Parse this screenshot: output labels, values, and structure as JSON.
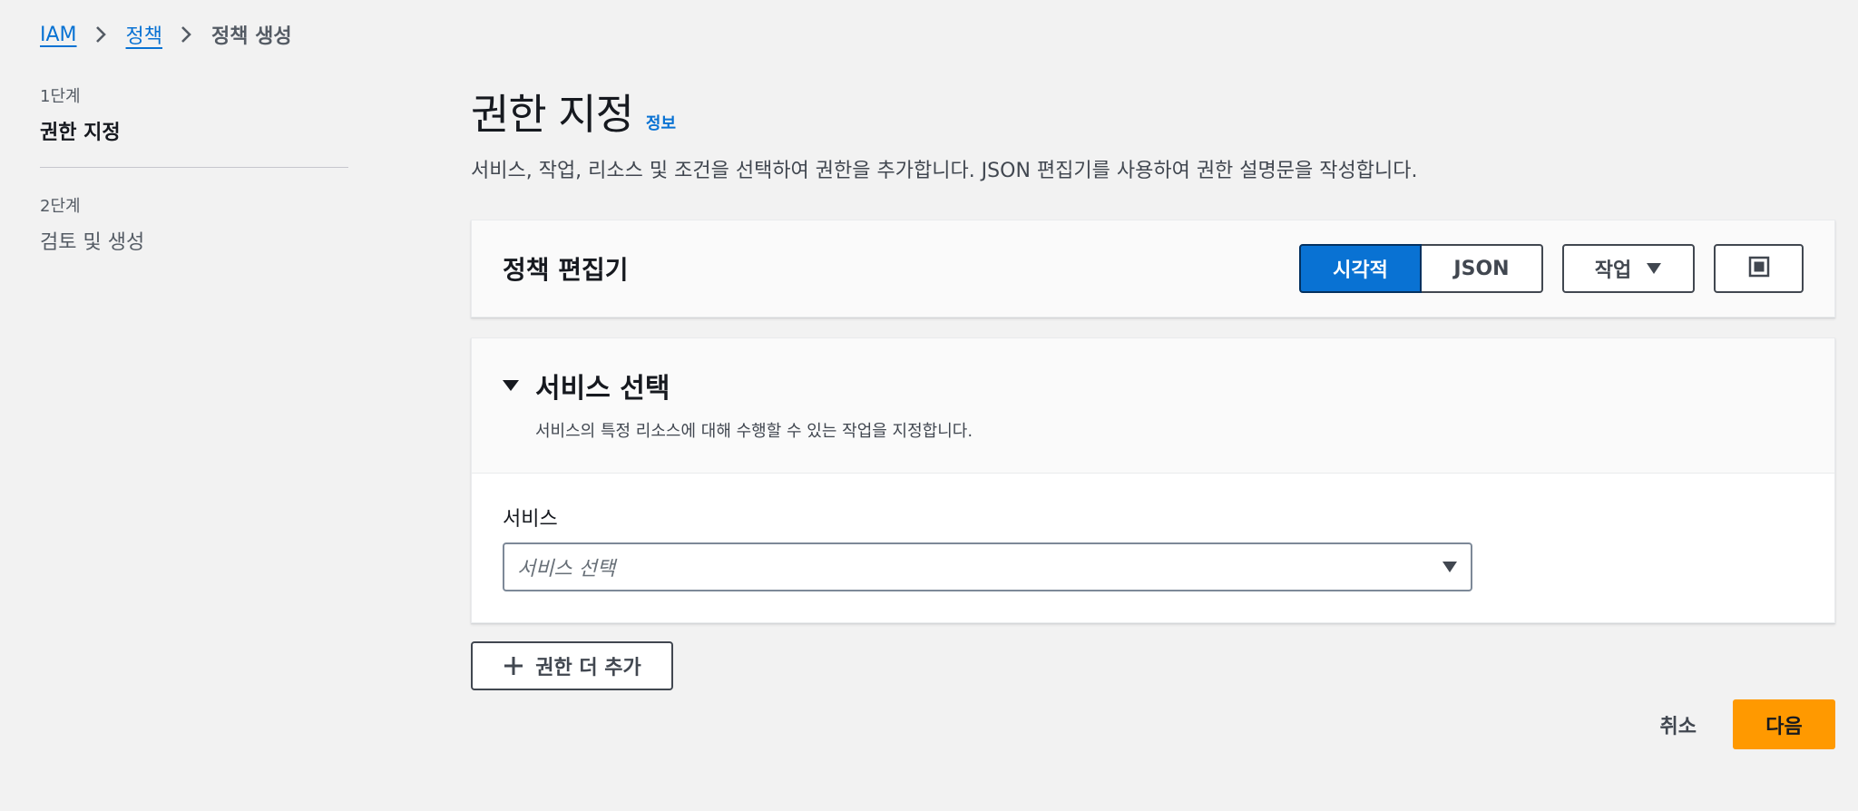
{
  "breadcrumb": {
    "items": [
      {
        "label": "IAM"
      },
      {
        "label": "정책"
      },
      {
        "label": "정책 생성"
      }
    ]
  },
  "steps": [
    {
      "number": "1단계",
      "title": "권한 지정",
      "active": true
    },
    {
      "number": "2단계",
      "title": "검토 및 생성",
      "active": false
    }
  ],
  "main": {
    "title": "권한 지정",
    "info_link": "정보",
    "description": "서비스, 작업, 리소스 및 조건을 선택하여 권한을 추가합니다. JSON 편집기를 사용하여 권한 설명문을 작성합니다."
  },
  "editor": {
    "title": "정책 편집기",
    "mode_visual": "시각적",
    "mode_json": "JSON",
    "actions_label": "작업",
    "fullscreen_icon": "fullscreen-icon"
  },
  "service_section": {
    "title": "서비스 선택",
    "description": "서비스의 특정 리소스에 대해 수행할 수 있는 작업을 지정합니다.",
    "field_label": "서비스",
    "select_placeholder": "서비스 선택"
  },
  "add_permission_label": "권한 더 추가",
  "footer": {
    "cancel_label": "취소",
    "next_label": "다음"
  },
  "colors": {
    "primary": "#0972d3",
    "primary_action": "#ff9900",
    "background": "#f2f2f2",
    "text": "#16191f"
  }
}
